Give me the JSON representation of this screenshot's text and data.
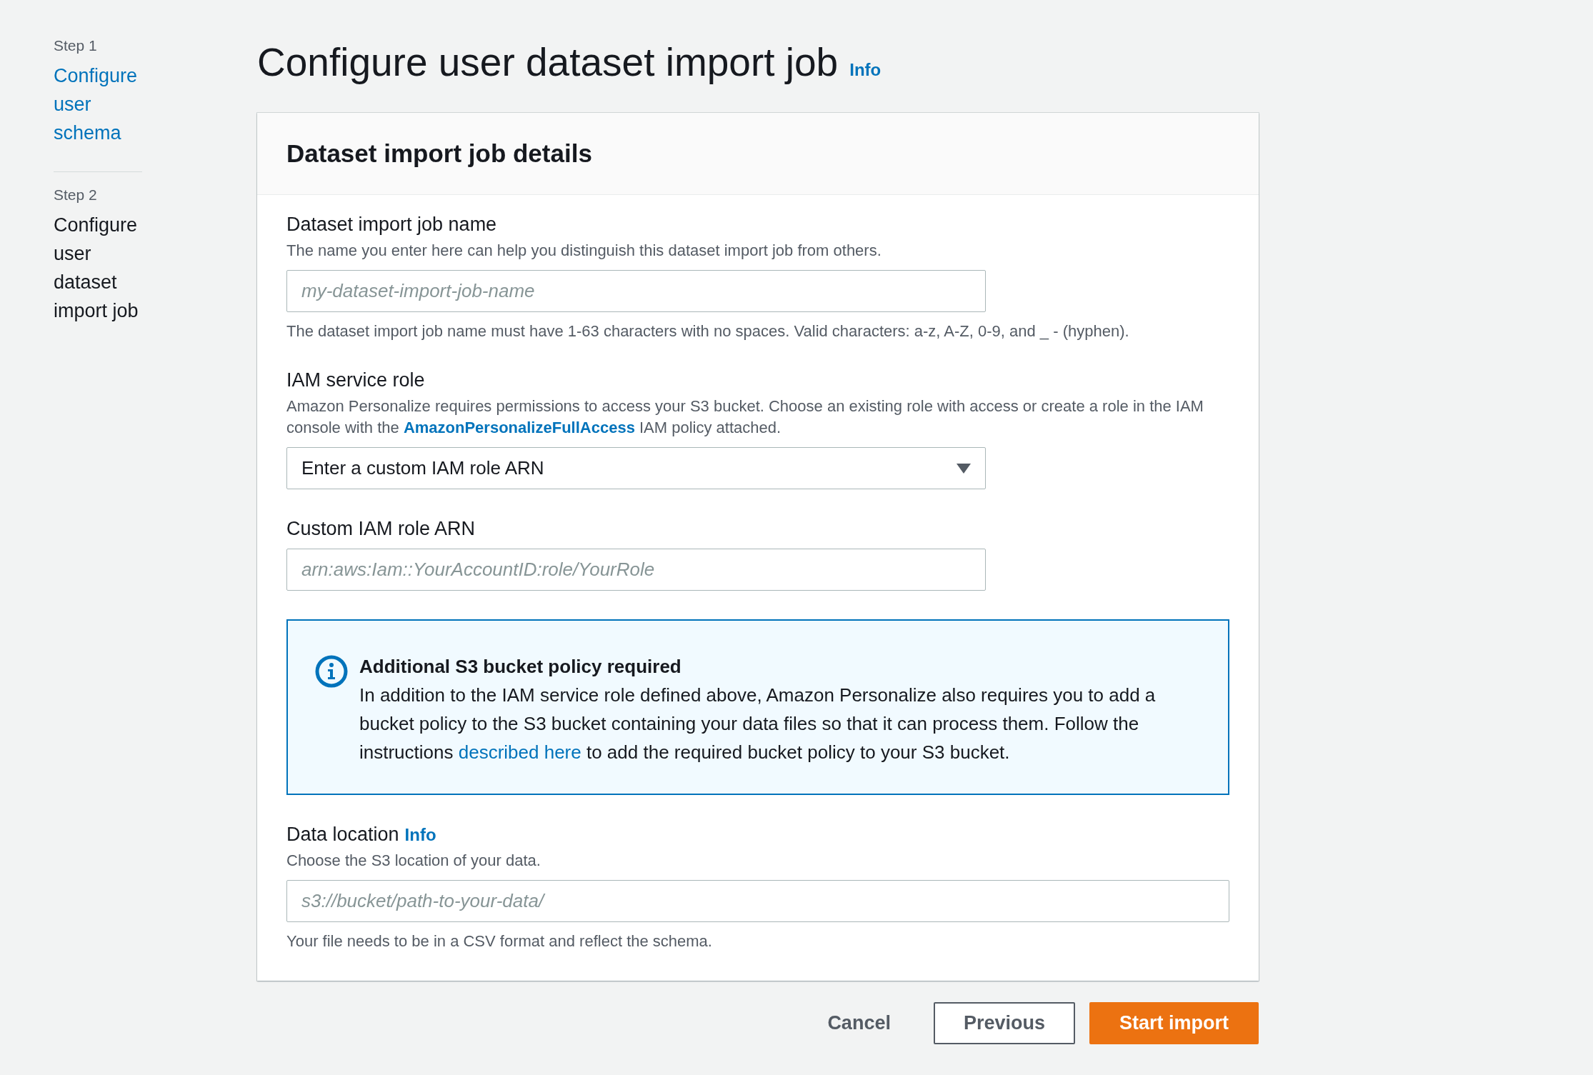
{
  "sidebar": {
    "steps": [
      {
        "step": "Step 1",
        "title": "Configure user schema",
        "selected": false
      },
      {
        "step": "Step 2",
        "title": "Configure user dataset import job",
        "selected": true
      }
    ]
  },
  "page": {
    "title": "Configure user dataset import job",
    "info": "Info"
  },
  "card": {
    "title": "Dataset import job details"
  },
  "fields": [
    {
      "kind": "input",
      "wide": false,
      "label": "Dataset import job name",
      "description": "The name you enter here can help you distinguish this dataset import job from others.",
      "placeholder": "my-dataset-import-job-name",
      "help": "The dataset import job name must have 1-63 characters with no spaces. Valid characters: a-z, A-Z, 0-9, and _ - (hyphen)."
    },
    {
      "kind": "select",
      "wide": false,
      "label": "IAM service role",
      "description": "Amazon Personalize requires permissions to access your S3 bucket. Choose an existing role with access or create a role in the IAM console with the",
      "link": "AmazonPersonalizeFullAccess",
      "description_after": "IAM policy attached.",
      "value": "Enter a custom IAM role ARN"
    },
    {
      "kind": "input",
      "wide": false,
      "label": "Custom IAM role ARN",
      "placeholder": "arn:aws:Iam::YourAccountID:role/YourRole"
    },
    {
      "kind": "alert",
      "title": "Additional S3 bucket policy required",
      "text": "In addition to the IAM service role defined above, Amazon Personalize also requires you to add a bucket policy to the S3 bucket containing your data files so that it can process them. Follow the instructions",
      "link": "described here",
      "text_after": "to add the required bucket policy to your S3 bucket."
    },
    {
      "kind": "input",
      "wide": true,
      "label": "Data location",
      "info": "Info",
      "description": "Choose the S3 location of your data.",
      "placeholder": "s3://bucket/path-to-your-data/",
      "help": "Your file needs to be in a CSV format and reflect the schema."
    }
  ],
  "buttons": [
    {
      "label": "Cancel",
      "kind": "link"
    },
    {
      "label": "Previous",
      "kind": "secondary"
    },
    {
      "label": "Start import",
      "kind": "primary"
    }
  ]
}
